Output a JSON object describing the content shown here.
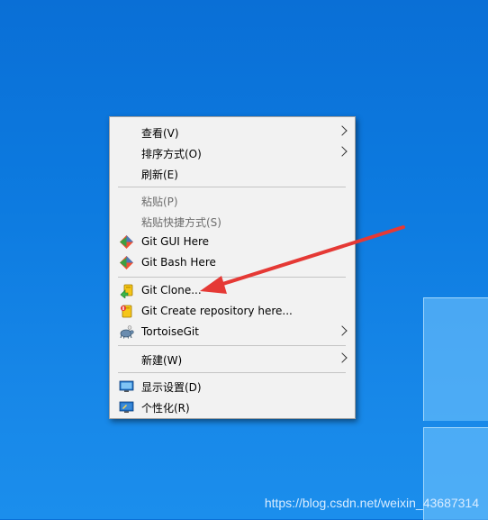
{
  "menu": {
    "items": [
      {
        "label": "查看(V)",
        "disabled": false,
        "submenu": true,
        "icon": null
      },
      {
        "label": "排序方式(O)",
        "disabled": false,
        "submenu": true,
        "icon": null
      },
      {
        "label": "刷新(E)",
        "disabled": false,
        "submenu": false,
        "icon": null
      },
      {
        "label": "粘贴(P)",
        "disabled": true,
        "submenu": false,
        "icon": null
      },
      {
        "label": "粘贴快捷方式(S)",
        "disabled": true,
        "submenu": false,
        "icon": null
      },
      {
        "label": "Git GUI Here",
        "disabled": false,
        "submenu": false,
        "icon": "git-diamond-icon"
      },
      {
        "label": "Git Bash Here",
        "disabled": false,
        "submenu": false,
        "icon": "git-diamond-icon"
      },
      {
        "label": "Git Clone...",
        "disabled": false,
        "submenu": false,
        "icon": "tortoisegit-clone-icon"
      },
      {
        "label": "Git Create repository here...",
        "disabled": false,
        "submenu": false,
        "icon": "tortoisegit-create-repo-icon"
      },
      {
        "label": "TortoiseGit",
        "disabled": false,
        "submenu": true,
        "icon": "tortoisegit-turtle-icon"
      },
      {
        "label": "新建(W)",
        "disabled": false,
        "submenu": true,
        "icon": null
      },
      {
        "label": "显示设置(D)",
        "disabled": false,
        "submenu": false,
        "icon": "display-monitor-icon"
      },
      {
        "label": "个性化(R)",
        "disabled": false,
        "submenu": false,
        "icon": "personalize-monitor-icon"
      }
    ]
  },
  "watermark": "https://blog.csdn.net/weixin_43687314",
  "colors": {
    "annotation_arrow": "#e53935",
    "desktop": "#0d7be0"
  }
}
